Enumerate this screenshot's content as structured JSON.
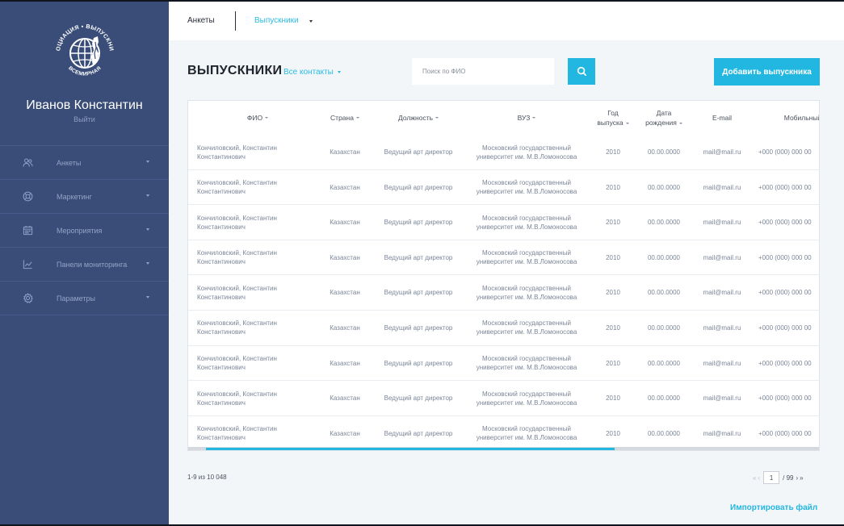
{
  "user": {
    "name": "Иванов Константин",
    "logout": "Выйти"
  },
  "sidebar": {
    "items": [
      {
        "label": "Анкеты",
        "icon": "users-icon"
      },
      {
        "label": "Маркетинг",
        "icon": "lifebuoy-icon"
      },
      {
        "label": "Мероприятия",
        "icon": "calendar-icon"
      },
      {
        "label": "Панели мониторинга",
        "icon": "chart-line-icon"
      },
      {
        "label": "Параметры",
        "icon": "gear-icon"
      }
    ]
  },
  "topbar": {
    "tab1": "Анкеты",
    "tab2": "Выпускники"
  },
  "header": {
    "title": "ВЫПУСКНИКИ",
    "filter": "Все контакты",
    "search_placeholder": "Поиск по ФИО",
    "add_button": "Добавить выпускника"
  },
  "table": {
    "columns": {
      "fio": "ФИО",
      "country": "Страна",
      "position": "Должность",
      "university": "ВУЗ",
      "year_1": "Год",
      "year_2": "выпуска",
      "birth_1": "Дата",
      "birth_2": "рождения",
      "email": "E-mail",
      "mobile": "Мобильный"
    },
    "rows": [
      {
        "fio_1": "Кончиловский, Константин",
        "fio_2": "Константинович",
        "country": "Казахстан",
        "position": "Ведущий арт директор",
        "uni_1": "Московский государственный",
        "uni_2": "университет им. М.В.Ломоносова",
        "year": "2010",
        "birth": "00.00.0000",
        "email": "mail@mail.ru",
        "mobile": "+000 (000) 000 00"
      },
      {
        "fio_1": "Кончиловский, Константин",
        "fio_2": "Константинович",
        "country": "Казахстан",
        "position": "Ведущий арт директор",
        "uni_1": "Московский государственный",
        "uni_2": "университет им. М.В.Ломоносова",
        "year": "2010",
        "birth": "00.00.0000",
        "email": "mail@mail.ru",
        "mobile": "+000 (000) 000 00"
      },
      {
        "fio_1": "Кончиловский, Константин",
        "fio_2": "Константинович",
        "country": "Казахстан",
        "position": "Ведущий арт директор",
        "uni_1": "Московский государственный",
        "uni_2": "университет им. М.В.Ломоносова",
        "year": "2010",
        "birth": "00.00.0000",
        "email": "mail@mail.ru",
        "mobile": "+000 (000) 000 00"
      },
      {
        "fio_1": "Кончиловский, Константин",
        "fio_2": "Константинович",
        "country": "Казахстан",
        "position": "Ведущий арт директор",
        "uni_1": "Московский государственный",
        "uni_2": "университет им. М.В.Ломоносова",
        "year": "2010",
        "birth": "00.00.0000",
        "email": "mail@mail.ru",
        "mobile": "+000 (000) 000 00"
      },
      {
        "fio_1": "Кончиловский, Константин",
        "fio_2": "Константинович",
        "country": "Казахстан",
        "position": "Ведущий арт директор",
        "uni_1": "Московский государственный",
        "uni_2": "университет им. М.В.Ломоносова",
        "year": "2010",
        "birth": "00.00.0000",
        "email": "mail@mail.ru",
        "mobile": "+000 (000) 000 00"
      },
      {
        "fio_1": "Кончиловский, Константин",
        "fio_2": "Константинович",
        "country": "Казахстан",
        "position": "Ведущий арт директор",
        "uni_1": "Московский государственный",
        "uni_2": "университет им. М.В.Ломоносова",
        "year": "2010",
        "birth": "00.00.0000",
        "email": "mail@mail.ru",
        "mobile": "+000 (000) 000 00"
      },
      {
        "fio_1": "Кончиловский, Константин",
        "fio_2": "Константинович",
        "country": "Казахстан",
        "position": "Ведущий арт директор",
        "uni_1": "Московский государственный",
        "uni_2": "университет им. М.В.Ломоносова",
        "year": "2010",
        "birth": "00.00.0000",
        "email": "mail@mail.ru",
        "mobile": "+000 (000) 000 00"
      },
      {
        "fio_1": "Кончиловский, Константин",
        "fio_2": "Константинович",
        "country": "Казахстан",
        "position": "Ведущий арт директор",
        "uni_1": "Московский государственный",
        "uni_2": "университет им. М.В.Ломоносова",
        "year": "2010",
        "birth": "00.00.0000",
        "email": "mail@mail.ru",
        "mobile": "+000 (000) 000 00"
      },
      {
        "fio_1": "Кончиловский, Константин",
        "fio_2": "Константинович",
        "country": "Казахстан",
        "position": "Ведущий арт директор",
        "uni_1": "Московский государственный",
        "uni_2": "университет им. М.В.Ломоносова",
        "year": "2010",
        "birth": "00.00.0000",
        "email": "mail@mail.ru",
        "mobile": "+000 (000) 000 00"
      }
    ]
  },
  "footer": {
    "row_count": "1-9 из 10 048",
    "current_page": "1",
    "total_pages": "/ 99",
    "import": "Импортировать файл"
  },
  "logo_text": "АССОЦИАЦИЯ ВЫПУСКНИКОВ ВСЕМИРНАЯ",
  "colors": {
    "sidebar": "#3a4d78",
    "accent": "#22b7e1",
    "background": "#f3f6f9"
  }
}
